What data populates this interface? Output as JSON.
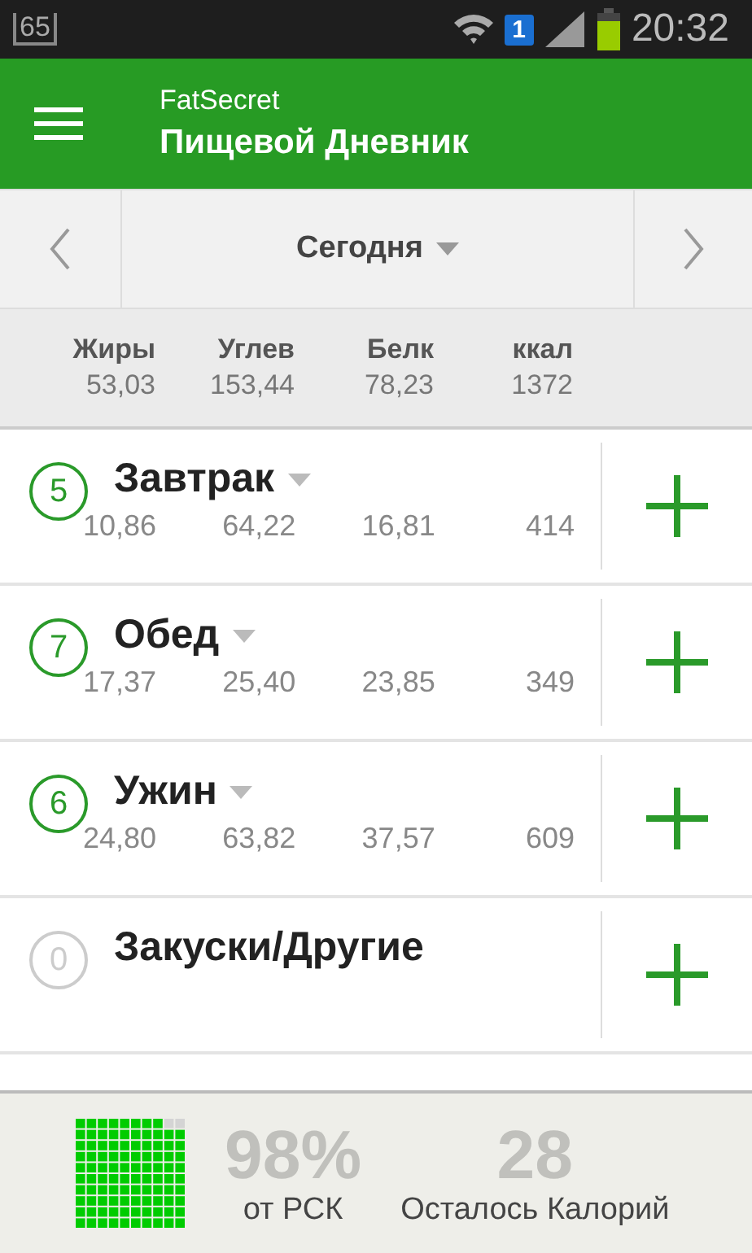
{
  "status_bar": {
    "notification": "65",
    "sim": "1",
    "time": "20:32"
  },
  "header": {
    "app_name": "FatSecret",
    "title": "Пищевой Дневник"
  },
  "date_nav": {
    "label": "Сегодня"
  },
  "totals": {
    "columns": [
      {
        "label": "Жиры",
        "value": "53,03"
      },
      {
        "label": "Углев",
        "value": "153,44"
      },
      {
        "label": "Белк",
        "value": "78,23"
      },
      {
        "label": "ккал",
        "value": "1372"
      }
    ]
  },
  "meals": [
    {
      "count": "5",
      "name": "Завтрак",
      "dropdown": true,
      "values": [
        "10,86",
        "64,22",
        "16,81",
        "414"
      ]
    },
    {
      "count": "7",
      "name": "Обед",
      "dropdown": true,
      "values": [
        "17,37",
        "25,40",
        "23,85",
        "349"
      ]
    },
    {
      "count": "6",
      "name": "Ужин",
      "dropdown": true,
      "values": [
        "24,80",
        "63,82",
        "37,57",
        "609"
      ]
    },
    {
      "count": "0",
      "name": "Закуски/Другие",
      "dropdown": false
    }
  ],
  "footer": {
    "rdi": {
      "value": "98%",
      "label": "от РСК"
    },
    "remaining": {
      "value": "28",
      "label": "Осталось Калорий"
    }
  }
}
